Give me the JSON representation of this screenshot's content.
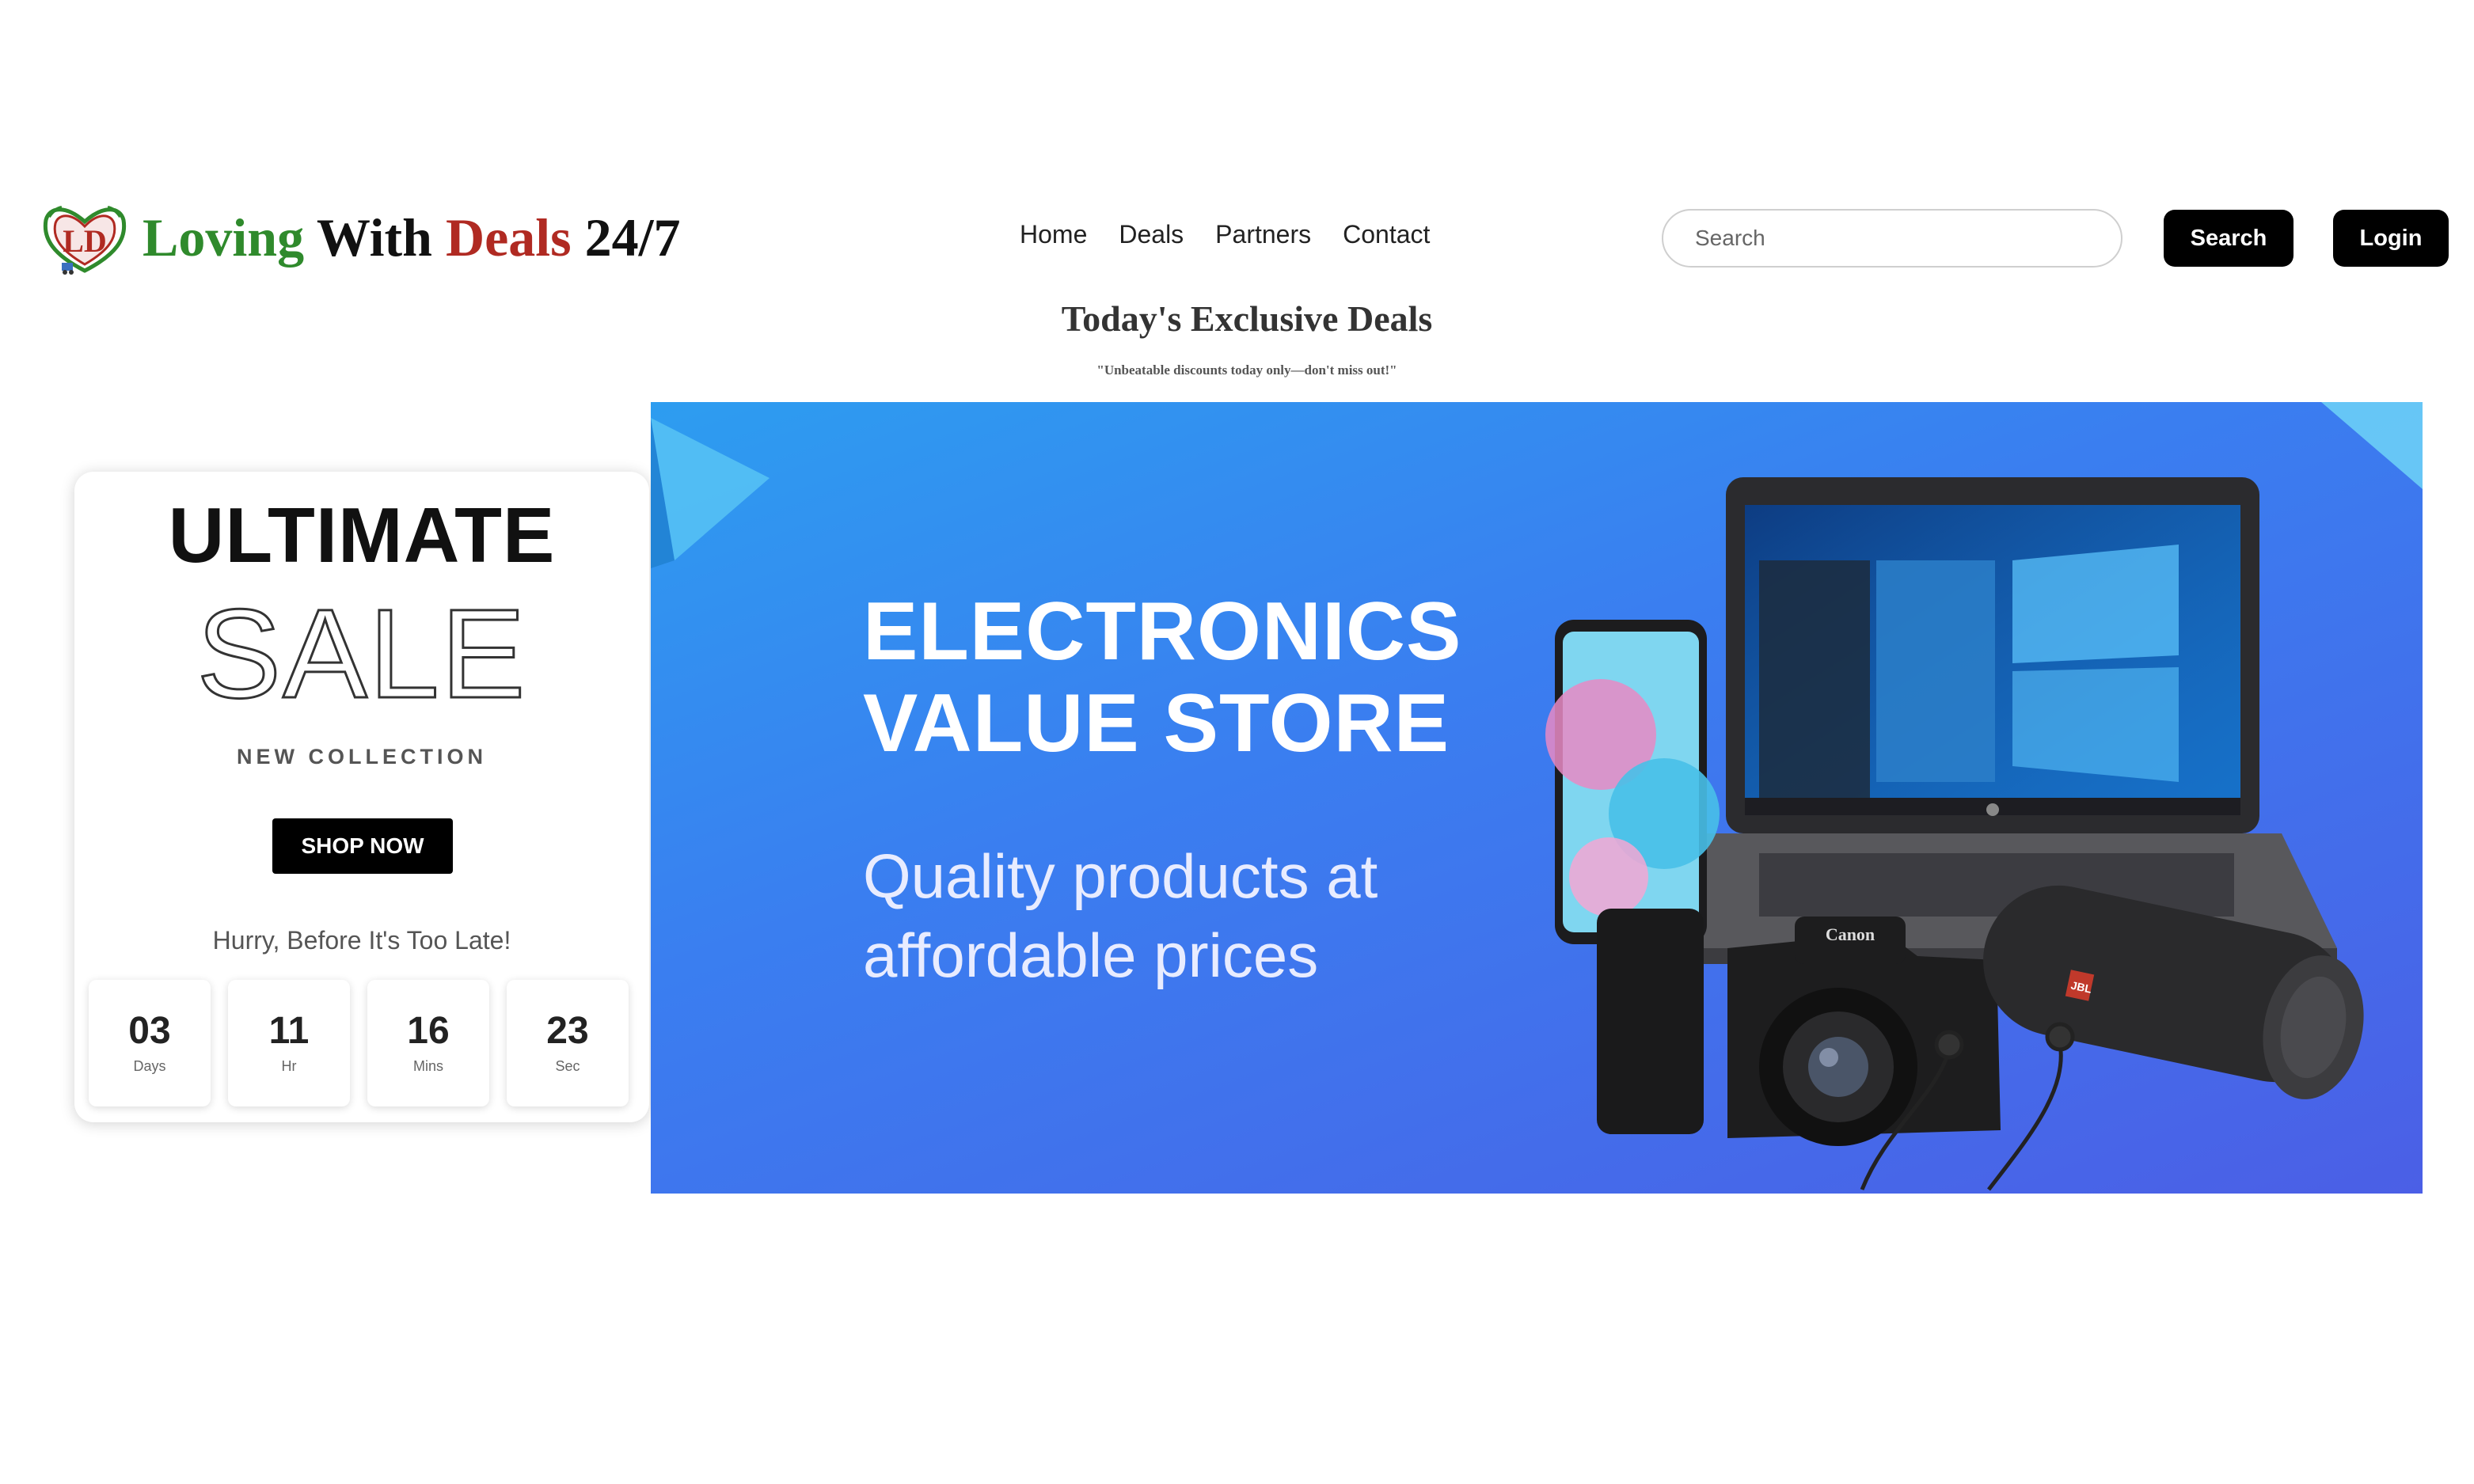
{
  "brand": {
    "logo_word1": "Loving",
    "logo_word2": "With",
    "logo_word3": "Deals",
    "logo_word4": "24/7",
    "logo_monogram": "LD"
  },
  "nav": {
    "items": [
      {
        "label": "Home"
      },
      {
        "label": "Deals"
      },
      {
        "label": "Partners"
      },
      {
        "label": "Contact"
      }
    ]
  },
  "search": {
    "placeholder": "Search",
    "value": "",
    "button_label": "Search"
  },
  "auth": {
    "login_label": "Login"
  },
  "hero": {
    "headline": "Today's Exclusive Deals",
    "subline": "\"Unbeatable discounts today only—don't miss out!\""
  },
  "promo": {
    "title": "ULTIMATE",
    "sale_word": "SALE",
    "collection": "NEW COLLECTION",
    "cta_label": "SHOP NOW",
    "urgency": "Hurry, Before It's Too Late!",
    "countdown": [
      {
        "value": "03",
        "unit": "Days"
      },
      {
        "value": "11",
        "unit": "Hr"
      },
      {
        "value": "16",
        "unit": "Mins"
      },
      {
        "value": "23",
        "unit": "Sec"
      }
    ]
  },
  "banner": {
    "title_line1": "ELECTRONICS",
    "title_line2": "VALUE STORE",
    "tagline_line1": "Quality products at",
    "tagline_line2": "affordable prices",
    "camera_brand": "Canon",
    "speaker_brand": "JBL"
  },
  "colors": {
    "brand_green": "#2f8a2c",
    "brand_red": "#b02a22",
    "banner_blue": "#3a7ef0",
    "button_black": "#000000"
  }
}
